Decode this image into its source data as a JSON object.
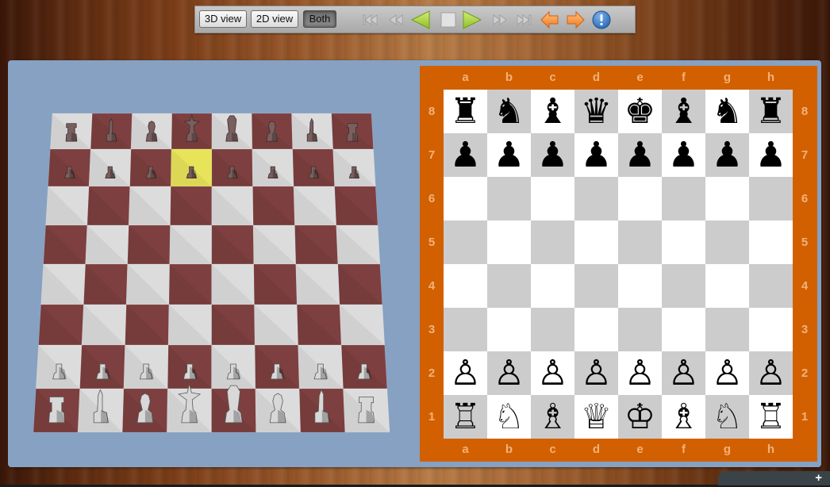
{
  "toolbar": {
    "view_buttons": [
      {
        "label": "3D view",
        "pressed": false
      },
      {
        "label": "2D view",
        "pressed": false
      },
      {
        "label": "Both",
        "pressed": true
      }
    ],
    "nav_icons": [
      {
        "name": "first-move-icon",
        "enabled": false
      },
      {
        "name": "rewind-icon",
        "enabled": false
      },
      {
        "name": "play-backward-icon",
        "enabled": true
      },
      {
        "name": "stop-icon",
        "enabled": true
      },
      {
        "name": "play-forward-icon",
        "enabled": true
      },
      {
        "name": "fast-forward-icon",
        "enabled": false
      },
      {
        "name": "last-move-icon",
        "enabled": false
      },
      {
        "name": "undo-arrow-icon",
        "enabled": true
      },
      {
        "name": "redo-arrow-icon",
        "enabled": true
      },
      {
        "name": "info-icon",
        "enabled": true
      }
    ]
  },
  "board3d": {
    "highlighted_square": "d7",
    "colors": {
      "light": "#dcdcdc",
      "dark": "#7d3f3f",
      "highlight": "#e8e45a",
      "black_piece": "#7a5f5f",
      "white_piece": "#d8d8d8"
    },
    "ranks": [
      [
        "r",
        "n",
        "b",
        "q",
        "k",
        "b",
        "n",
        "r"
      ],
      [
        "p",
        "p",
        "p",
        "p",
        "p",
        "p",
        "p",
        "p"
      ],
      [
        "",
        "",
        "",
        "",
        "",
        "",
        "",
        ""
      ],
      [
        "",
        "",
        "",
        "",
        "",
        "",
        "",
        ""
      ],
      [
        "",
        "",
        "",
        "",
        "",
        "",
        "",
        ""
      ],
      [
        "",
        "",
        "",
        "",
        "",
        "",
        "",
        ""
      ],
      [
        "P",
        "P",
        "P",
        "P",
        "P",
        "P",
        "P",
        "P"
      ],
      [
        "R",
        "N",
        "B",
        "Q",
        "K",
        "B",
        "N",
        "R"
      ]
    ]
  },
  "board2d": {
    "files": [
      "a",
      "b",
      "c",
      "d",
      "e",
      "f",
      "g",
      "h"
    ],
    "ranks": [
      "8",
      "7",
      "6",
      "5",
      "4",
      "3",
      "2",
      "1"
    ],
    "colors": {
      "frame": "#d26000",
      "label": "#f3b27a",
      "light": "#ffffff",
      "dark": "#cccccc"
    },
    "position": [
      [
        "♜",
        "♞",
        "♝",
        "♛",
        "♚",
        "♝",
        "♞",
        "♜"
      ],
      [
        "♟",
        "♟",
        "♟",
        "♟",
        "♟",
        "♟",
        "♟",
        "♟"
      ],
      [
        "",
        "",
        "",
        "",
        "",
        "",
        "",
        ""
      ],
      [
        "",
        "",
        "",
        "",
        "",
        "",
        "",
        ""
      ],
      [
        "",
        "",
        "",
        "",
        "",
        "",
        "",
        ""
      ],
      [
        "",
        "",
        "",
        "",
        "",
        "",
        "",
        ""
      ],
      [
        "♙",
        "♙",
        "♙",
        "♙",
        "♙",
        "♙",
        "♙",
        "♙"
      ],
      [
        "♖",
        "♘",
        "♗",
        "♕",
        "♔",
        "♗",
        "♘",
        "♖"
      ]
    ]
  },
  "corner_bar": {
    "label": "+"
  }
}
